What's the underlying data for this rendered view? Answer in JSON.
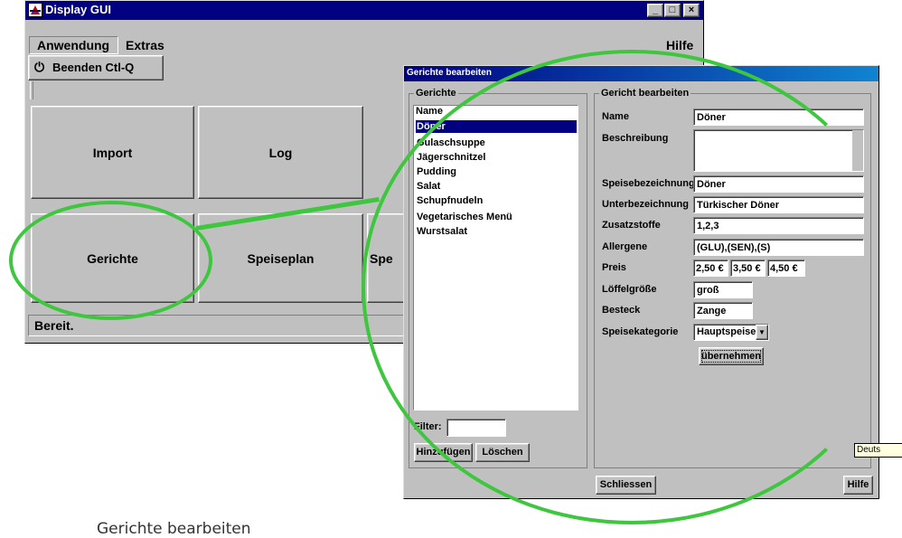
{
  "main_window": {
    "title": "Display GUI",
    "title_buttons": [
      "_",
      "□",
      "×"
    ],
    "menu": {
      "anwendung": "Anwendung",
      "extras": "Extras",
      "hilfe": "Hilfe"
    },
    "beenden_item": "Beenden Ctl-Q",
    "buttons": {
      "import": "Import",
      "log": "Log",
      "gerichte": "Gerichte",
      "speiseplan": "Speiseplan",
      "partial": "Spe"
    },
    "status": "Bereit."
  },
  "dialog": {
    "title": "Gerichte bearbeiten",
    "list_group": "Gerichte",
    "list_header": "Name",
    "dishes": [
      "Döner",
      "Gulaschsuppe",
      "Jägerschnitzel",
      "Pudding",
      "Salat",
      "Schupfnudeln",
      "Vegetarisches Menü",
      "Wurstsalat"
    ],
    "selected_index": 0,
    "filter_label": "Filter:",
    "filter_value": "",
    "add_button": "Hinzufügen",
    "delete_button": "Löschen",
    "edit_group": "Gericht bearbeiten",
    "labels": {
      "name": "Name",
      "beschreibung": "Beschreibung",
      "speisebezeichnung": "Speisebezeichnung",
      "unterbezeichnung": "Unterbezeichnung",
      "zusatzstoffe": "Zusatzstoffe",
      "allergene": "Allergene",
      "preis": "Preis",
      "loeffelgroesse": "Löffelgröße",
      "besteck": "Besteck",
      "speisekategorie": "Speisekategorie"
    },
    "values": {
      "name": "Döner",
      "beschreibung": "",
      "speisebezeichnung": "Döner",
      "unterbezeichnung": "Türkischer Döner",
      "zusatzstoffe": "1,2,3",
      "allergene": "(GLU),(SEN),(S)",
      "preis": [
        "2,50 €",
        "3,50 €",
        "4,50 €"
      ],
      "loeffelgroesse": "groß",
      "besteck": "Zange",
      "speisekategorie": "Hauptspeise"
    },
    "apply_button": "übernehmen",
    "close_button": "Schliessen",
    "help_button": "Hilfe"
  },
  "tooltip": "Deuts",
  "caption": "Gerichte bearbeiten",
  "colors": {
    "highlight": "#3ec63e",
    "titlebar": "#000080",
    "selection": "#000080"
  }
}
